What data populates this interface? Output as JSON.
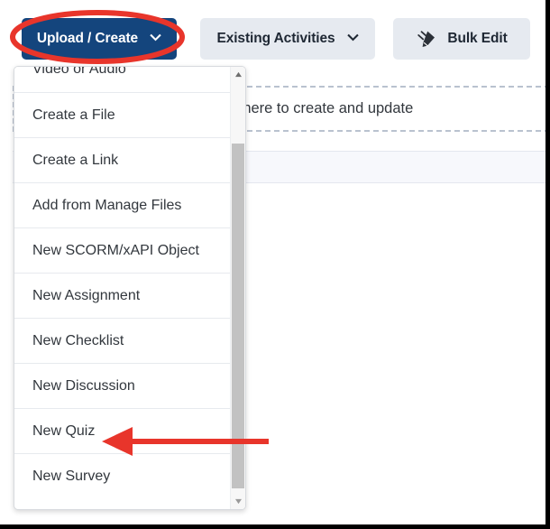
{
  "toolbar": {
    "upload_create": {
      "label": "Upload / Create",
      "icon": "chevron-down-icon"
    },
    "existing_activities": {
      "label": "Existing Activities",
      "icon": "chevron-down-icon"
    },
    "bulk_edit": {
      "label": "Bulk Edit",
      "icon": "pencil-icon"
    }
  },
  "dropdown": {
    "open": true,
    "items": [
      {
        "label": "Video or Audio"
      },
      {
        "label": "Create a File"
      },
      {
        "label": "Create a Link"
      },
      {
        "label": "Add from Manage Files"
      },
      {
        "label": "New SCORM/xAPI Object"
      },
      {
        "label": "New Assignment"
      },
      {
        "label": "New Checklist"
      },
      {
        "label": "New Discussion"
      },
      {
        "label": "New Quiz"
      },
      {
        "label": "New Survey"
      }
    ],
    "scrollbar": {
      "up_icon": "caret-up-icon",
      "down_icon": "caret-down-icon"
    }
  },
  "content": {
    "dropzone_text": "and drop files here to create and update",
    "activity_row": ""
  },
  "annotations": {
    "highlight_ellipse": {
      "target": "Upload / Create",
      "color": "#e8352b"
    },
    "callout_arrow": {
      "target": "New Quiz",
      "direction": "left",
      "color": "#e8352b"
    }
  },
  "colors": {
    "primary_button": "#14457d",
    "secondary_button": "#e6eaf0",
    "annotation_red": "#e8352b",
    "row_highlight": "#f7f8fc",
    "scrollbar_thumb": "#c2c2c2"
  }
}
